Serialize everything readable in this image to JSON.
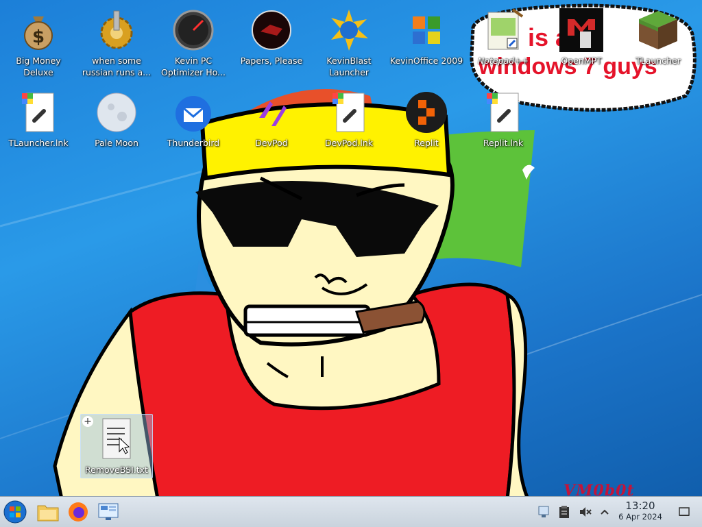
{
  "desktop": {
    "watermark": "VM0b0t",
    "bubble_text_top": "is  ally",
    "bubble_text_bottom": "windows 7 guys",
    "icons": [
      {
        "label": "Big Money Deluxe"
      },
      {
        "label": "when some russian runs a..."
      },
      {
        "label": "Kevin PC Optimizer Ho..."
      },
      {
        "label": "Papers, Please"
      },
      {
        "label": "KevinBlast Launcher"
      },
      {
        "label": "KevinOffice 2009"
      },
      {
        "label": "Notepad++"
      },
      {
        "label": "OpenMPT"
      },
      {
        "label": "TLauncher"
      },
      {
        "label": "TLauncher.lnk"
      },
      {
        "label": "Pale Moon"
      },
      {
        "label": "Thunderbird"
      },
      {
        "label": "DevPod"
      },
      {
        "label": "DevPod.lnk"
      },
      {
        "label": "Replit"
      },
      {
        "label": "Replit.lnk"
      },
      {
        "label": "RemoveBSI.txt"
      }
    ]
  },
  "taskbar": {
    "time": "13:20",
    "date": "6 Apr 2024"
  }
}
